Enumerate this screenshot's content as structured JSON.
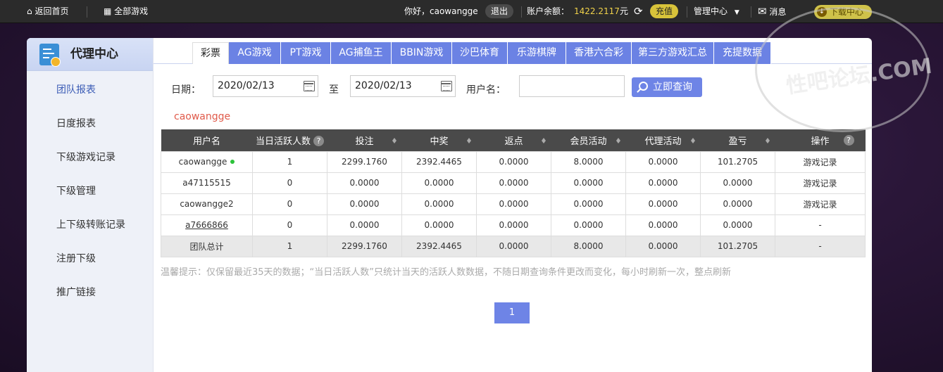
{
  "topbar": {
    "home": "返回首页",
    "all_games": "全部游戏",
    "greeting": "你好，caowangge",
    "logout": "退出",
    "balance_label": "账户余额：",
    "balance": "1422.2117",
    "unit": "元",
    "recharge": "充值",
    "manage": "管理中心",
    "messages": "消息",
    "download": "下载中心"
  },
  "sidebar": {
    "title": "代理中心",
    "items": [
      "团队报表",
      "日度报表",
      "下级游戏记录",
      "下级管理",
      "上下级转账记录",
      "注册下级",
      "推广链接"
    ]
  },
  "tabs": [
    "彩票",
    "AG游戏",
    "PT游戏",
    "AG捕鱼王",
    "BBIN游戏",
    "沙巴体育",
    "乐游棋牌",
    "香港六合彩",
    "第三方游戏汇总",
    "充提数据"
  ],
  "filter": {
    "date_label": "日期：",
    "date_from": "2020/02/13",
    "to_label": "至",
    "date_to": "2020/02/13",
    "user_label": "用户名：",
    "user_value": "",
    "query": "立即查询"
  },
  "current_user": "caowangge",
  "table": {
    "headers": [
      "用户名",
      "当日活跃人数",
      "投注",
      "中奖",
      "返点",
      "会员活动",
      "代理活动",
      "盈亏",
      "操作"
    ],
    "rows": [
      [
        "caowangge",
        "1",
        "2299.1760",
        "2392.4465",
        "0.0000",
        "8.0000",
        "0.0000",
        "101.2705",
        "游戏记录"
      ],
      [
        "a47115515",
        "0",
        "0.0000",
        "0.0000",
        "0.0000",
        "0.0000",
        "0.0000",
        "0.0000",
        "游戏记录"
      ],
      [
        "caowangge2",
        "0",
        "0.0000",
        "0.0000",
        "0.0000",
        "0.0000",
        "0.0000",
        "0.0000",
        "游戏记录"
      ],
      [
        "a7666866",
        "0",
        "0.0000",
        "0.0000",
        "0.0000",
        "0.0000",
        "0.0000",
        "0.0000",
        "-"
      ]
    ],
    "total": [
      "团队总计",
      "1",
      "2299.1760",
      "2392.4465",
      "0.0000",
      "8.0000",
      "0.0000",
      "101.2705",
      "-"
    ]
  },
  "tip": "温馨提示：仅保留最近35天的数据；“当日活跃人数”只统计当天的活跃人数数据，不随日期查询条件更改而变化，每小时刷新一次，整点刷新",
  "pagination": {
    "current": "1"
  },
  "watermark": "性吧论坛.COM"
}
